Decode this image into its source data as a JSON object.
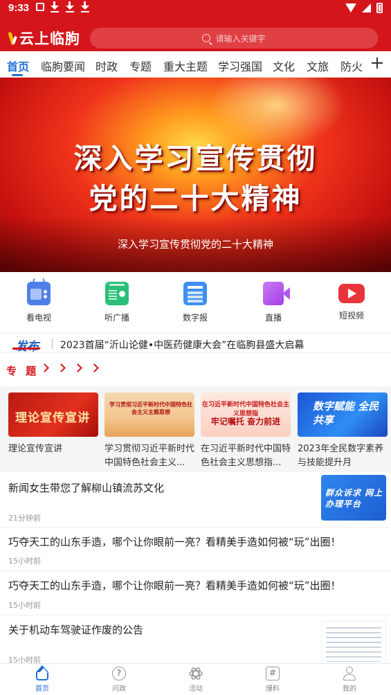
{
  "status_bar": {
    "time": "9:33"
  },
  "header": {
    "app_title": "云上临朐",
    "search_placeholder": "请输入关键字"
  },
  "tabs": [
    "首页",
    "临朐要闻",
    "时政",
    "专题",
    "重大主题",
    "学习强国",
    "文化",
    "文旅",
    "防火"
  ],
  "banner": {
    "headline_line1": "深入学习宣传贯彻",
    "headline_line2": "党的二十大精神",
    "caption": "深入学习宣传贯彻党的二十大精神"
  },
  "quick_entries": [
    {
      "label": "看电视",
      "icon": "tv-icon"
    },
    {
      "label": "听广播",
      "icon": "radio-icon"
    },
    {
      "label": "数字报",
      "icon": "newspaper-icon"
    },
    {
      "label": "直播",
      "icon": "live-camera-icon"
    },
    {
      "label": "短视频",
      "icon": "short-video-icon"
    }
  ],
  "ticker": {
    "badge": "发布",
    "text": "2023首届“沂山论健•中医药健康大会”在临朐县盛大启幕"
  },
  "topics": {
    "title": "专 题",
    "cards": [
      {
        "image_text": "理论宣传宣讲",
        "caption": "理论宣传宣讲"
      },
      {
        "image_text": "学习贯彻习近平新时代中国特色社会主义主题思想",
        "caption": "学习贯彻习近平新时代中国特色社会主义..."
      },
      {
        "image_text": "在习近平新时代中国特色社会主义思想指",
        "image_sub": "牢记嘱托 奋力前进",
        "caption": "在习近平新时代中国特色社会主义思想指..."
      },
      {
        "image_text": "数字赋能 全民共享",
        "caption": "2023年全民数字素养与技能提升月"
      }
    ]
  },
  "news": [
    {
      "title": "新闻女生带您了解柳山镇流苏文化",
      "time": "21分钟前",
      "thumb_text": "群众诉求 网上办理平台"
    },
    {
      "title": "巧夺天工的山东手造，哪个让你眼前一亮？看精美手造如何被“玩”出圈！",
      "time": "15小时前"
    },
    {
      "title": "巧夺天工的山东手造，哪个让你眼前一亮？看精美手造如何被“玩”出圈！",
      "time": "15小时前"
    },
    {
      "title": "关于机动车驾驶证作废的公告",
      "time": "15小时前"
    }
  ],
  "bottom_nav": [
    {
      "label": "首页",
      "icon": "home-icon"
    },
    {
      "label": "问政",
      "icon": "question-icon"
    },
    {
      "label": "活动",
      "icon": "activity-icon"
    },
    {
      "label": "爆料",
      "icon": "report-icon"
    },
    {
      "label": "我的",
      "icon": "user-icon"
    }
  ],
  "colors": {
    "brand_red": "#d4161c",
    "accent_blue": "#1f6fd6"
  }
}
